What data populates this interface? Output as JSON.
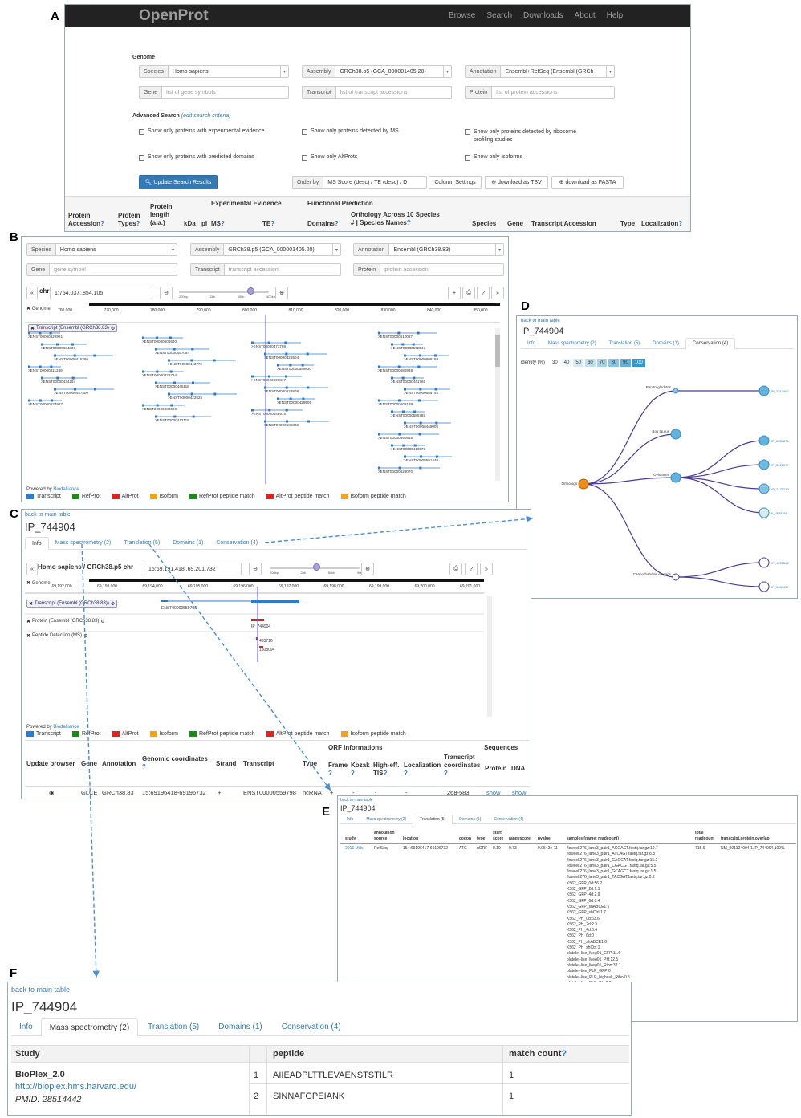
{
  "panel_labels": {
    "a": "A",
    "b": "B",
    "c": "C",
    "d": "D",
    "e": "E",
    "f": "F"
  },
  "colors": {
    "transcript": "#2b7bd2",
    "refprot": "#1b8a1b",
    "altprot": "#e32020",
    "isoform": "#f2a31c",
    "refprot_peptide": "#1b8a1b",
    "altprot_peptide": "#e32020",
    "isoform_peptide": "#f2a31c",
    "link": "#337ab7",
    "nav": "#222222"
  },
  "a": {
    "brand": "OpenProt",
    "nav": [
      "Browse",
      "Search",
      "Downloads",
      "About",
      "Help"
    ],
    "genome_heading": "Genome",
    "species_label": "Species",
    "species_value": "Homo sapiens",
    "assembly_label": "Assembly",
    "assembly_value": "GRCh38.p5 (GCA_000001405.20)",
    "annotation_label": "Annotation",
    "annotation_value": "Ensembl+RefSeq (Ensembl (GRCh",
    "gene_label": "Gene",
    "gene_placeholder": "list of gene symbols",
    "transcript_label": "Transcript",
    "transcript_placeholder": "list of transcript accessions",
    "protein_label": "Protein",
    "protein_placeholder": "list of protein accessions",
    "adv_heading": "Advanced Search",
    "adv_link": "(edit search criteria)",
    "checkboxes": [
      "Show only proteins with experimental evidence",
      "Show only proteins detected by MS",
      "Show only proteins detected by ribosome profiling studies",
      "Show only proteins with predicted domains",
      "Show only AltProts",
      "Show only Isoforms"
    ],
    "update_btn": "Update Search Results",
    "orderby_label": "Order by",
    "orderby_value": "MS Score (desc) / TE (desc) / D",
    "col_settings": "Column Settings",
    "dl_tsv": "download as TSV",
    "dl_fasta": "download as FASTA",
    "headers": {
      "protein": "Protein",
      "accession": "Accession",
      "types1": "Protein",
      "types2": "Types",
      "len1": "Protein",
      "len2": "length",
      "len3": "(a.a.)",
      "kda": "kDa",
      "pi": "pI",
      "exp": "Experimental Evidence",
      "func": "Functional Prediction",
      "ms": "MS",
      "te": "TE",
      "domains": "Domains",
      "orth": "Orthology Across 10 Species",
      "orth2": "# | Species Names",
      "species": "Species",
      "gene": "Gene",
      "tacc": "Transcript Accession",
      "type": "Type",
      "loc": "Localization",
      "q": "?"
    }
  },
  "b": {
    "species_label": "Species",
    "species_value": "Homo sapiens",
    "assembly_label": "Assembly",
    "assembly_value": "GRCh38.p5 (GCA_000001405.20)",
    "annotation_label": "Annotation",
    "annotation_value": "Ensembl (GRCh38.83)",
    "gene_label": "Gene",
    "gene_placeholder": "gene symbol",
    "transcript_label": "Transcript",
    "transcript_placeholder": "transcript accession",
    "protein_label": "Protein",
    "protein_placeholder": "protein accession",
    "back": "«",
    "chr_label": "chr",
    "chr_value": "1:754,037..854,105",
    "zoom_ticks": [
      "200bp",
      "2kb",
      "50kb",
      "500kb"
    ],
    "ctrl": [
      "+",
      "⎙",
      "?",
      "»"
    ],
    "genome_label": "Genome",
    "ruler": [
      "760,000",
      "770,000",
      "780,000",
      "790,000",
      "800,000",
      "810,000",
      "820,000",
      "830,000",
      "840,000",
      "850,000"
    ],
    "track_label": "Transcript (Ensembl (GRCh38.83)",
    "transcripts": [
      "ENST00000622921",
      "ENST00000634337",
      "ENST00000415295",
      "ENST00000411249",
      "ENST00000434264",
      "ENST00000447500",
      "ENST00000624927",
      "ENST00000506640",
      "ENST00000457084",
      "ENST00000443772",
      "ENST00000328734",
      "ENST00000445118",
      "ENST00000422528",
      "ENST00000589699",
      "ENST00000412115",
      "ENST00000473798",
      "ENST00000426504",
      "ENST00000589830",
      "ENST00000590817",
      "ENST00000623808",
      "ENST00000429505",
      "ENST00000448975",
      "ENST00000585826",
      "ENST00000610087",
      "ENST00000592547",
      "ENST00000608169",
      "ENST00000586928",
      "ENST00000441765",
      "ENST00000585745",
      "ENST00000609139",
      "ENST00000585788",
      "ENST00000449005",
      "ENST00000590848",
      "ENST00000416570",
      "ENST00000591440",
      "ENST00000623070"
    ],
    "powered": "Powered by",
    "powered_link": "Biodalliance",
    "legend": [
      "Transcript",
      "RefProt",
      "AltProt",
      "Isoform",
      "RefProt peptide match",
      "AltProt peptide match",
      "Isoform peptide match"
    ]
  },
  "c": {
    "back": "back to main table",
    "title": "IP_744904",
    "tabs": [
      "Info",
      "Mass spectrometry (2)",
      "Translation (5)",
      "Domains (1)",
      "Conservation (4)"
    ],
    "nav_back": "«",
    "loc_label": "Homo sapiens / GRCh38.p5 chr",
    "loc_value": "15:69,191,418..69,201,732",
    "zoom_ticks": [
      "200bp",
      "2kb",
      "50kb",
      "500kb"
    ],
    "ctrl": [
      "⎙",
      "?",
      "»"
    ],
    "genome_label": "Genome",
    "ruler": [
      "69,192,000",
      "69,193,000",
      "69,194,000",
      "69,195,000",
      "69,196,000",
      "69,197,000",
      "69,198,000",
      "69,199,000",
      "69,200,000",
      "69,201,000"
    ],
    "track_transcript": "Transcript (Ensembl (GRCh38.83))",
    "transcript_name": "ENST00000559798",
    "track_protein": "Protein (Ensembl (GRCh38.83)",
    "protein_name": "IP_744904",
    "track_peptide": "Peptide Detection (MS)",
    "pep1": "433716",
    "pep2": "1508094",
    "powered": "Powered by",
    "powered_link": "Biodalliance",
    "legend": [
      "Transcript",
      "RefProt",
      "AltProt",
      "Isoform",
      "RefProt peptide match",
      "AltProt peptide match",
      "Isoform peptide match"
    ],
    "headers": {
      "update": "Update browser",
      "gene": "Gene",
      "annot": "Annotation",
      "gcoord": "Genomic coordinates",
      "strand": "Strand",
      "transcript": "Transcript",
      "type": "Type",
      "orf": "ORF informations",
      "seq": "Sequences",
      "frame": "Frame",
      "kozak": "Kozak",
      "high": "High-eff. TIS",
      "loc": "Localization",
      "tcoord": "Transcript coordinates",
      "protein": "Protein",
      "dna": "DNA",
      "q": "?"
    },
    "row": {
      "radio": "◉",
      "gene": "GLCE",
      "annot": "GRCh38.83",
      "gcoord": "15:69196418-69196732",
      "strand": "+",
      "transcript": "ENST00000559798",
      "type": "ncRNA",
      "frame": "+",
      "kozak": "-",
      "high": "-",
      "loc": "-",
      "tcoord": "268-583",
      "protein": "show",
      "dna": "show"
    }
  },
  "d": {
    "back": "back to main table",
    "title": "IP_744904",
    "tabs": [
      "Info",
      "Mass spectrometry (2)",
      "Translation (5)",
      "Domains (1)",
      "Conservation (4)"
    ],
    "identity_label": "identity (%)",
    "identity_scale": [
      "30",
      "40",
      "50",
      "60",
      "70",
      "80",
      "90",
      "100"
    ],
    "nodes": {
      "root": "Orthologs",
      "pan": "Pan troglodytes",
      "bos": "Bos taurus",
      "ovis": "Ovis aries",
      "cae": "Caenorhabditis elegans"
    },
    "leaves": [
      "IP_2313462",
      "IP_2850874",
      "IP_3122077",
      "IP_2176719",
      "II_2878365",
      "IP_1595562",
      "IP_1484197"
    ]
  },
  "e": {
    "back": "back to main table",
    "title": "IP_744904",
    "tabs": [
      "Info",
      "Mass spectrometry (2)",
      "Translation (5)",
      "Domains (1)",
      "Conservation (4)"
    ],
    "headers": {
      "study": "study",
      "annot1": "annotation",
      "annot2": "source",
      "location": "location",
      "codon": "codon",
      "type": "type",
      "start1": "start",
      "start2": "score",
      "range": "rangescore",
      "pvalue": "pvalue",
      "samples": "samples (name: readcount)",
      "total1": "total",
      "total2": "readcount",
      "tpo": "transcript,protein,overlap"
    },
    "row": {
      "study": "2016 Mills",
      "annot": "RefSeq",
      "location": "15+:69196417-69196732",
      "codon": "ATG",
      "type": "uORF",
      "start": "0.19",
      "range": "0.73",
      "pvalue": "9.0542e-11",
      "total": "715.6",
      "tpo": "NM_001324094.1,IP_744904,100%"
    },
    "samples": [
      "flowcell276_lane3_pair1_ACGACT.fastq.tar.gz:19.7",
      "flowcell276_lane3_pair1_ATCAGT.fastq.tar.gz:8.8",
      "flowcell276_lane3_pair1_CAGCAT.fastq.tar.gz:15.2",
      "flowcell276_lane3_pair1_CGACGT.fastq.tar.gz:5.5",
      "flowcell276_lane3_pair1_GCAGCT.fastq.tar.gz:1.5",
      "flowcell276_lane3_pair1_TACGAT.fastq.tar.gz:0.2",
      "K562_GFP_0d:56.2",
      "K562_GFP_2d:9.1",
      "K562_GFP_4d:2.9",
      "K562_GFP_6d:6.4",
      "K562_GFP_shABCE1:1",
      "K562_GFP_shCtrl:1.7",
      "K562_PH_0d:63.6",
      "K562_PH_2d:2.3",
      "K562_PH_4d:0.4",
      "K562_PH_6d:0",
      "K562_PH_shABCE1:0",
      "K562_PH_shCtrl:1",
      "platelet-like_Meg01_GFP:11.6",
      "platelet-like_Meg01_PH:12.5",
      "platelet-like_Meg01_Ribo:32.1",
      "platelet-like_PLP_GFP:0",
      "platelet-like_PLP_highsalt_Ribo:0.5",
      "platelet-like_PLP_PH:0.8",
      "platelet-like_PLP_Ribo:4"
    ]
  },
  "f": {
    "back": "back to main table",
    "title": "IP_744904",
    "tabs": [
      "Info",
      "Mass spectrometry (2)",
      "Translation (5)",
      "Domains (1)",
      "Conservation (4)"
    ],
    "headers": {
      "study": "Study",
      "peptide": "peptide",
      "match": "match count",
      "q": "?"
    },
    "study_name": "BioPlex_2.0",
    "study_url": "http://bioplex.hms.harvard.edu/",
    "pmid": "PMID: 28514442",
    "rows": [
      {
        "n": "1",
        "peptide": "AIIEADPLTTLEVAENSTSTILR",
        "count": "1"
      },
      {
        "n": "2",
        "peptide": "SINNAFGPEIANK",
        "count": "1"
      }
    ]
  }
}
